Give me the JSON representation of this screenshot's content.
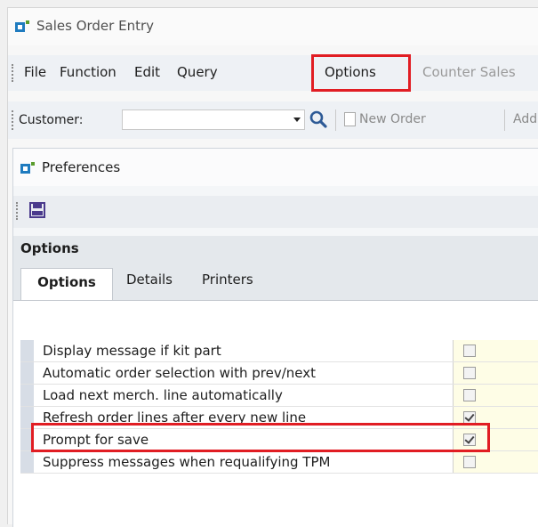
{
  "window": {
    "title": "Sales Order Entry"
  },
  "menu": {
    "items": [
      {
        "label": "File"
      },
      {
        "label": "Function"
      },
      {
        "label": "Edit"
      },
      {
        "label": "Query"
      },
      {
        "label": "Options"
      },
      {
        "label": "Counter Sales"
      }
    ],
    "highlighted": "Options"
  },
  "toolbar": {
    "customer_label": "Customer:",
    "customer_value": "",
    "new_order_label": "New Order",
    "add_label": "Add"
  },
  "preferences": {
    "title": "Preferences",
    "section_title": "Options",
    "tabs": [
      {
        "label": "Options",
        "active": true
      },
      {
        "label": "Details",
        "active": false
      },
      {
        "label": "Printers",
        "active": false
      }
    ],
    "settings": [
      {
        "label": "Display message if kit part",
        "checked": false
      },
      {
        "label": "Automatic order selection with prev/next",
        "checked": false
      },
      {
        "label": "Load next merch. line automatically",
        "checked": false
      },
      {
        "label": "Refresh order lines after every new line",
        "checked": true
      },
      {
        "label": "Prompt for save",
        "checked": true,
        "highlighted": true
      },
      {
        "label": "Suppress messages when requalifying TPM",
        "checked": false
      }
    ]
  },
  "colors": {
    "highlight": "#e11d23",
    "accent": "#1f7bbf"
  }
}
